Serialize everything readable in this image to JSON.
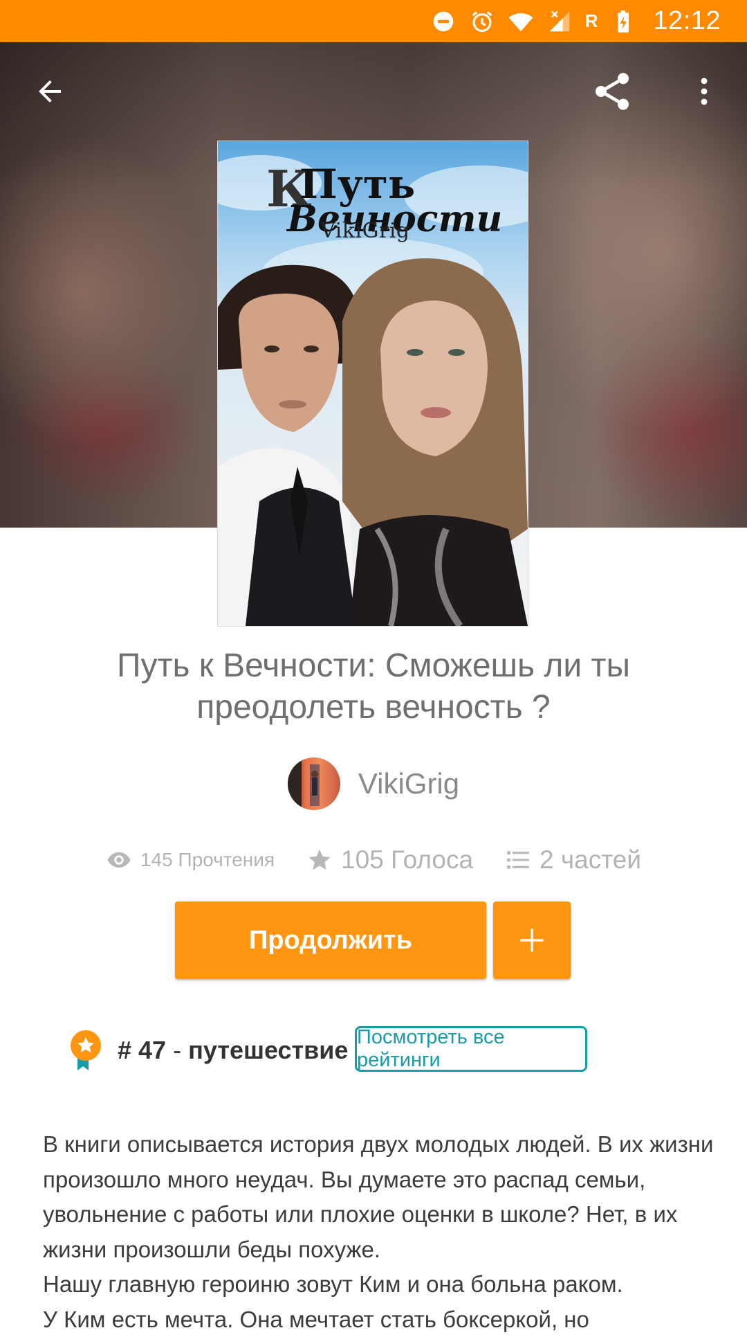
{
  "status_bar": {
    "time": "12:12",
    "carrier_letter": "R",
    "background": "#ff8a00",
    "icons": [
      "do-not-disturb-icon",
      "alarm-icon",
      "wifi-icon",
      "signal-icon",
      "battery-charging-icon"
    ]
  },
  "toolbar": {
    "icons": [
      "back-arrow-icon",
      "share-icon",
      "more-vertical-icon"
    ]
  },
  "cover": {
    "title_letter": "К",
    "title_line1": "Путь",
    "title_line2": "Вечности",
    "author": "VikiGrig"
  },
  "story": {
    "title": "Путь к Вечности: Сможешь ли ты преодолеть вечность ?",
    "author": "VikiGrig",
    "reads": "145 Прочтения",
    "votes": "105 Голоса",
    "parts": "2 частей"
  },
  "actions": {
    "continue_label": "Продолжить",
    "add_icon": "plus-icon",
    "accent": "#ff9612"
  },
  "ranking": {
    "rank": "# 47",
    "separator": "-",
    "category": "путешествие",
    "view_all_label": "Посмотреть все рейтинги",
    "accent": "#1a9ca8"
  },
  "description": {
    "text": "В книги описывается история двух молодых людей. В их жизни произошло много неудач.  Вы думаете это распад семьи, увольнение с работы или плохие оценки в школе? Нет, в их жизни произошли беды похуже.\nНашу главную героиню зовут Ким и она больна раком.\nУ Ким есть мечта. Она мечтает стать боксеркой, но"
  }
}
